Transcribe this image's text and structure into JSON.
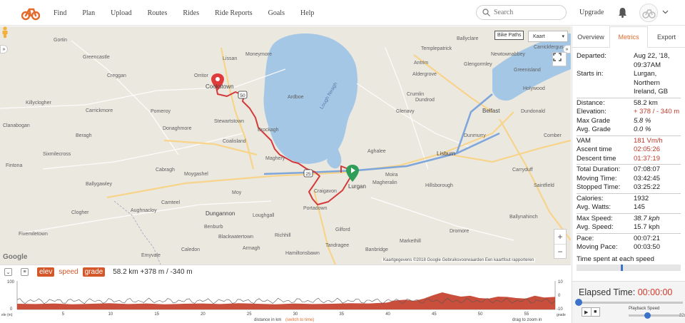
{
  "nav": {
    "items": [
      "Find",
      "Plan",
      "Upload",
      "Routes",
      "Rides",
      "Ride Reports",
      "Goals",
      "Help"
    ],
    "search_placeholder": "Search",
    "upgrade": "Upgrade"
  },
  "map": {
    "type_select": "Kaart",
    "bike_paths": "Bike Paths",
    "attribution": "Kaartgegevens ©2018 Google   Gebruiksvoorwaarden   Een kaartfout rapporteren",
    "google": "Google",
    "labels": {
      "lough_neagh": "Lough Neagh",
      "belfast": "Belfast",
      "lisburn": "Lisburn",
      "lurgan": "Lurgan",
      "cookstown": "Cookstown",
      "craigavon": "Craigavon",
      "portadown": "Portadown",
      "antrim": "Antrim",
      "moira": "Moira",
      "magheralin": "Magheralin",
      "dungannon": "Dungannon",
      "armagh": "Armagh",
      "banbridge": "Banbridge",
      "omagh_area": "Carrickmore",
      "stewartstown": "Stewartstown",
      "coalisland": "Coalisland",
      "moy": "Moy",
      "glenavy": "Glenavy",
      "crumlin": "Crumlin",
      "aghalee": "Aghalee",
      "holywood": "Holywood",
      "dundonald": "Dundonald",
      "dunmurry": "Dunmurry",
      "hillsborough": "Hillsborough",
      "ardboe": "Ardboe",
      "moneymore": "Moneymore",
      "brockagh": "Brockagh",
      "maghery": "Maghery",
      "templepatrick": "Templepatrick",
      "ballyclare": "Ballyclare",
      "greenisland": "Greenisland",
      "newtownabbey": "Newtownabbey",
      "carrickfergus": "Carrickfergus",
      "comber": "Comber",
      "saintfield": "Saintfield",
      "ballynahinch": "Ballynahinch",
      "dromore": "Dromore",
      "tandragee": "Tandragee",
      "richhill": "Richhill",
      "loughgall": "Loughgall",
      "gilford": "Gilford",
      "hamiltonsbawn": "Hamiltonsbawn",
      "markethill": "Markethill",
      "aughnacloy": "Aughnacloy",
      "caledon": "Caledon",
      "emyvale": "Emyvale",
      "clogher": "Clogher",
      "fivemiletown": "Fivemiletown",
      "ballygawley": "Ballygawley",
      "cabragh": "Cabragh",
      "donaghmore": "Donaghmore",
      "pomeroy": "Pomeroy",
      "beragh": "Beragh",
      "sixmilecross": "Sixmilecross",
      "fintona": "Fintona",
      "greencastle": "Greencastle",
      "creggan": "Creggan",
      "gortin": "Gortin",
      "lissan": "Lissan",
      "orritor": "Orritor",
      "killyclogher": "Killyclogher",
      "clanabogan": "Clanabogan",
      "aldergrove": "Aldergrove",
      "dundrod": "Dundrod",
      "glengormley": "Glengormley",
      "carryduff": "Carryduff",
      "moygashel": "Moygashel",
      "camteel": "Camteel",
      "benburb": "Benburb",
      "blackwatertown": "Blackwatertown"
    }
  },
  "elevation": {
    "tags": [
      "elev",
      "speed",
      "grade"
    ],
    "summary": "58.2 km +378 m / -340 m",
    "x_label": "distance in km",
    "x_switch": "(switch to time)",
    "hint": "drag to zoom in",
    "y_left_label": "ele (m)",
    "y_right_label": "grade",
    "y_left_ticks": [
      "100",
      "0"
    ],
    "y_right_ticks": [
      "10",
      "0",
      "-10"
    ],
    "x_ticks": [
      "5",
      "10",
      "15",
      "20",
      "25",
      "30",
      "35",
      "40",
      "45",
      "50",
      "55"
    ]
  },
  "chart_data": {
    "type": "area",
    "x": [
      0,
      2,
      4,
      6,
      8,
      10,
      12,
      14,
      16,
      18,
      20,
      22,
      24,
      26,
      28,
      30,
      32,
      34,
      36,
      38,
      40,
      41,
      42,
      43,
      44,
      45,
      46,
      47,
      48,
      49,
      50,
      51,
      52,
      53,
      54,
      55,
      56,
      57,
      58.2
    ],
    "elevation": [
      20,
      19,
      21,
      18,
      20,
      22,
      19,
      21,
      18,
      20,
      21,
      19,
      22,
      20,
      18,
      21,
      19,
      20,
      22,
      21,
      24,
      32,
      34,
      30,
      38,
      50,
      60,
      52,
      45,
      48,
      40,
      38,
      45,
      44,
      40,
      38,
      48,
      42,
      44
    ],
    "xlabel": "distance in km",
    "ylabel": "ele (m)",
    "xlim": [
      0,
      58.2
    ],
    "ylim": [
      0,
      100
    ],
    "grade_ylim": [
      -10,
      10
    ]
  },
  "panel": {
    "tabs": [
      "Overview",
      "Metrics",
      "Export"
    ],
    "active_tab": "Metrics",
    "rows_top": [
      {
        "k": "Departed:",
        "v": "Aug 22, '18, 09:37AM",
        "style": ""
      },
      {
        "k": "Starts in:",
        "v": "Lurgan, Northern Ireland, GB",
        "style": ""
      }
    ],
    "rows_a": [
      {
        "k": "Distance:",
        "v": "58.2 km",
        "style": ""
      },
      {
        "k": "Elevation:",
        "v": "+ 378 / - 340 m",
        "style": "red"
      },
      {
        "k": "Max Grade",
        "v": "5.8 %",
        "style": "it"
      },
      {
        "k": "Avg. Grade",
        "v": "0.0 %",
        "style": "it"
      }
    ],
    "rows_b": [
      {
        "k": "VAM",
        "v": "181 Vm/h",
        "style": "red"
      },
      {
        "k": "Ascent time",
        "v": "02:05:26",
        "style": "red"
      },
      {
        "k": "Descent time",
        "v": "01:37:19",
        "style": "red"
      }
    ],
    "rows_c": [
      {
        "k": "Total Duration:",
        "v": "07:08:07",
        "style": ""
      },
      {
        "k": "Moving Time:",
        "v": "03:42:45",
        "style": ""
      },
      {
        "k": "Stopped Time:",
        "v": "03:25:22",
        "style": ""
      }
    ],
    "rows_d": [
      {
        "k": "Calories:",
        "v": "1932",
        "style": ""
      },
      {
        "k": "Avg. Watts:",
        "v": "145",
        "style": ""
      }
    ],
    "rows_e": [
      {
        "k": "Max Speed:",
        "v": "38.7 kph",
        "style": "it"
      },
      {
        "k": "Avg. Speed:",
        "v": "15.7 kph",
        "style": ""
      }
    ],
    "rows_f": [
      {
        "k": "Pace:",
        "v": "00:07:21",
        "style": ""
      },
      {
        "k": "Moving Pace:",
        "v": "00:03:50",
        "style": ""
      }
    ],
    "time_speed_title": "Time spent at each speed",
    "elapsed_label": "Elapsed Time:",
    "elapsed_value": "00:00:00",
    "playback_label": "Playback Speed",
    "playback_value": "32x"
  },
  "colors": {
    "accent": "#e36b2b",
    "route": "#c0392b",
    "water": "#a5c7e6",
    "elevation_fill": "#c94f3c"
  }
}
